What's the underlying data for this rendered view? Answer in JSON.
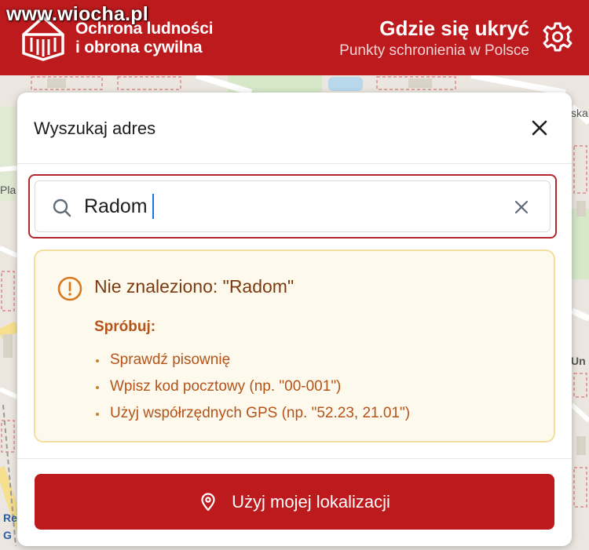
{
  "watermark": "www.wiocha.pl",
  "header": {
    "org_line1": "Ochrona ludności",
    "org_line2": "i obrona cywilna",
    "title": "Gdzie się ukryć",
    "subtitle": "Punkty schronienia w Polsce",
    "settings_icon": "gear-icon",
    "background": "#bd1a1d"
  },
  "map": {
    "labels": [
      "ska",
      "Un",
      "Pla",
      "Re",
      "G"
    ]
  },
  "search_dialog": {
    "title": "Wyszukaj adres",
    "close_icon": "close-icon",
    "search_icon": "search-icon",
    "input_value": "Radom",
    "clear_icon": "clear-icon",
    "focus_color": "#b3262b"
  },
  "notice": {
    "icon": "warning-icon",
    "title": "Nie znaleziono: \"Radom\"",
    "try_label": "Spróbuj:",
    "tips": [
      "Sprawdź pisownię",
      "Wpisz kod pocztowy (np. \"00-001\")",
      "Użyj współrzędnych GPS (np. \"52.23, 21.01\")"
    ],
    "background": "#fdf9ec",
    "text_color": "#b4531a"
  },
  "footer": {
    "locate_icon": "location-pin-icon",
    "locate_label": "Użyj mojej lokalizacji"
  }
}
